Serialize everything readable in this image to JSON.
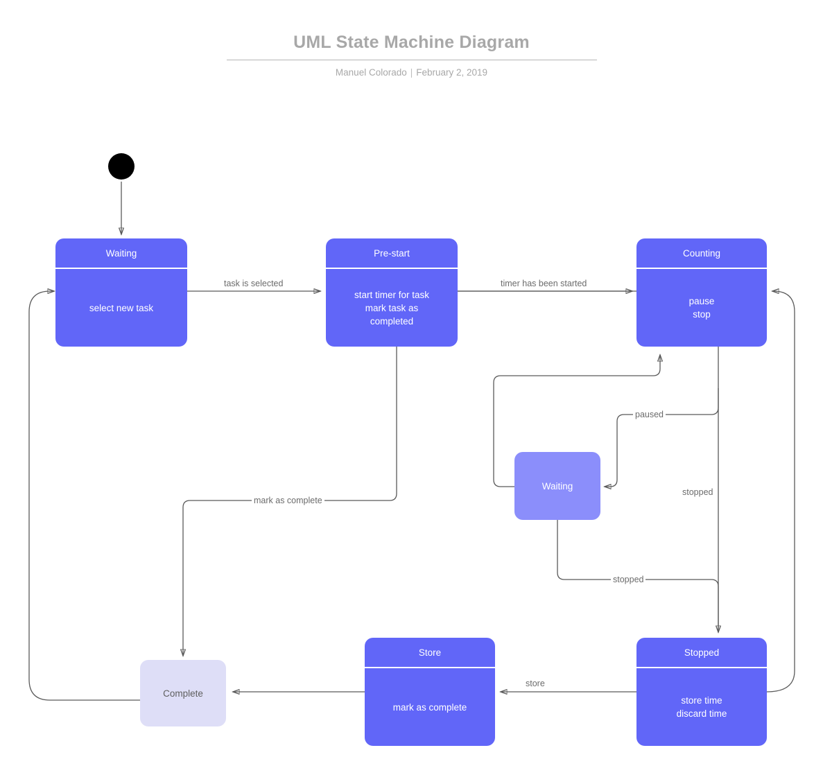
{
  "header": {
    "title": "UML State Machine Diagram",
    "author": "Manuel Colorado",
    "separator": "|",
    "date": "February 2, 2019"
  },
  "colors": {
    "node_fill": "#6166f8",
    "node_fill_light": "#8b8efb",
    "node_fill_pale": "#dedef7",
    "node_text": "#ffffff",
    "pale_text": "#5e5e5e",
    "edge_stroke": "#595959",
    "title_text": "#a8a8a8",
    "initial_fill": "#000000",
    "background": "#ffffff"
  },
  "diagram": {
    "type": "uml-state-machine",
    "initial_state": {
      "name": "initial-pseudostate",
      "shape": "filled-circle"
    },
    "nodes": [
      {
        "id": "waiting",
        "title": "Waiting",
        "body": "select new task",
        "style": "compartment"
      },
      {
        "id": "prestart",
        "title": "Pre-start",
        "body": "start timer for task\nmark task as\ncompleted",
        "body_lines": [
          "start timer for task",
          "mark task as",
          "completed"
        ],
        "style": "compartment"
      },
      {
        "id": "counting",
        "title": "Counting",
        "body": "pause\nstop",
        "body_lines": [
          "pause",
          "stop"
        ],
        "style": "compartment"
      },
      {
        "id": "waiting2",
        "title": "Waiting",
        "body": "",
        "style": "simple-light"
      },
      {
        "id": "complete",
        "title": "Complete",
        "body": "",
        "style": "simple-pale"
      },
      {
        "id": "store",
        "title": "Store",
        "body": "mark as complete",
        "style": "compartment"
      },
      {
        "id": "stopped",
        "title": "Stopped",
        "body": "store time\ndiscard time",
        "body_lines": [
          "store time",
          "discard time"
        ],
        "style": "compartment"
      }
    ],
    "transitions": [
      {
        "id": "t1",
        "from": "initial",
        "to": "waiting",
        "label": ""
      },
      {
        "id": "t2",
        "from": "waiting",
        "to": "prestart",
        "label": "task is selected"
      },
      {
        "id": "t3",
        "from": "prestart",
        "to": "counting",
        "label": "timer has been started"
      },
      {
        "id": "t4",
        "from": "prestart",
        "to": "complete",
        "label": "mark as complete"
      },
      {
        "id": "t5",
        "from": "counting",
        "to": "waiting2",
        "label": "paused"
      },
      {
        "id": "t6",
        "from": "waiting2",
        "to": "counting",
        "label": ""
      },
      {
        "id": "t7",
        "from": "counting",
        "to": "stopped",
        "label": "stopped"
      },
      {
        "id": "t8",
        "from": "waiting2",
        "to": "stopped",
        "label": "stopped"
      },
      {
        "id": "t9",
        "from": "stopped",
        "to": "store",
        "label": "store"
      },
      {
        "id": "t10",
        "from": "store",
        "to": "complete",
        "label": ""
      },
      {
        "id": "t11",
        "from": "stopped",
        "to": "counting",
        "label": ""
      },
      {
        "id": "t12",
        "from": "complete",
        "to": "waiting",
        "label": ""
      }
    ]
  }
}
